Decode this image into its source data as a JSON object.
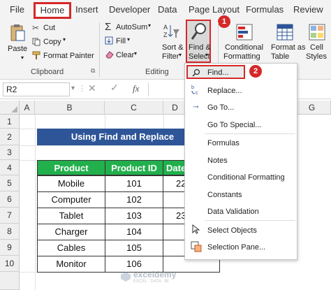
{
  "tabs": [
    "File",
    "Home",
    "Insert",
    "Developer",
    "Data",
    "Page Layout",
    "Formulas",
    "Review"
  ],
  "clipboard": {
    "paste": "Paste",
    "cut": "Cut",
    "copy": "Copy",
    "format_painter": "Format Painter",
    "group": "Clipboard"
  },
  "editing": {
    "autosum": "AutoSum",
    "fill": "Fill",
    "clear": "Clear",
    "sort_filter_1": "Sort &",
    "sort_filter_2": "Filter",
    "find_select_1": "Find &",
    "find_select_2": "Select",
    "group": "Editing"
  },
  "styles": {
    "conditional_1": "Conditional",
    "conditional_2": "Formatting",
    "format_table_1": "Format as",
    "format_table_2": "Table",
    "cell_styles_1": "Cell",
    "cell_styles_2": "Styles"
  },
  "formula_bar": {
    "name_box": "R2",
    "fx": "fx"
  },
  "columns": [
    "A",
    "B",
    "C",
    "D",
    "G"
  ],
  "rows": [
    "1",
    "2",
    "3",
    "4",
    "5",
    "6",
    "7",
    "8",
    "9",
    "10"
  ],
  "sheet": {
    "title": "Using Find and Replace",
    "headers": [
      "Product",
      "Product ID",
      "Date"
    ],
    "rows": [
      {
        "product": "Mobile",
        "id": "101",
        "date": "22"
      },
      {
        "product": "Computer",
        "id": "102",
        "date": ""
      },
      {
        "product": "Tablet",
        "id": "103",
        "date": "23"
      },
      {
        "product": "Charger",
        "id": "104",
        "date": ""
      },
      {
        "product": "Cables",
        "id": "105",
        "date": ""
      },
      {
        "product": "Monitor",
        "id": "106",
        "date": ""
      }
    ]
  },
  "menu": {
    "find": "Find...",
    "replace": "Replace...",
    "goto": "Go To...",
    "goto_special": "Go To Special...",
    "formulas": "Formulas",
    "notes": "Notes",
    "conditional_formatting": "Conditional Formatting",
    "constants": "Constants",
    "data_validation": "Data Validation",
    "select_objects": "Select Objects",
    "selection_pane": "Selection Pane..."
  },
  "badges": {
    "one": "1",
    "two": "2"
  },
  "watermark": {
    "name": "exceldemy",
    "sub": "EXCEL · DATA · BI"
  },
  "colors": {
    "accent_red": "#d62828",
    "header_green": "#22b04c",
    "title_blue": "#2e5597"
  }
}
